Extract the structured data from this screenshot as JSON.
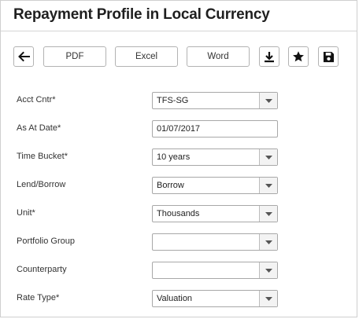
{
  "page": {
    "title": "Repayment Profile in Local Currency"
  },
  "toolbar": {
    "back_icon": "arrow-left-icon",
    "pdf_label": "PDF",
    "excel_label": "Excel",
    "word_label": "Word",
    "download_icon": "download-icon",
    "favorite_icon": "star-icon",
    "save_icon": "floppy-disk-icon"
  },
  "form": {
    "acct_cntr": {
      "label": "Acct Cntr*",
      "value": "TFS-SG"
    },
    "as_at_date": {
      "label": "As At Date*",
      "value": "01/07/2017"
    },
    "time_bucket": {
      "label": "Time Bucket*",
      "value": "10 years"
    },
    "lend_borrow": {
      "label": "Lend/Borrow",
      "value": "Borrow"
    },
    "unit": {
      "label": "Unit*",
      "value": "Thousands"
    },
    "portfolio_group": {
      "label": "Portfolio Group",
      "value": ""
    },
    "counterparty": {
      "label": "Counterparty",
      "value": ""
    },
    "rate_type": {
      "label": "Rate Type*",
      "value": "Valuation"
    }
  }
}
